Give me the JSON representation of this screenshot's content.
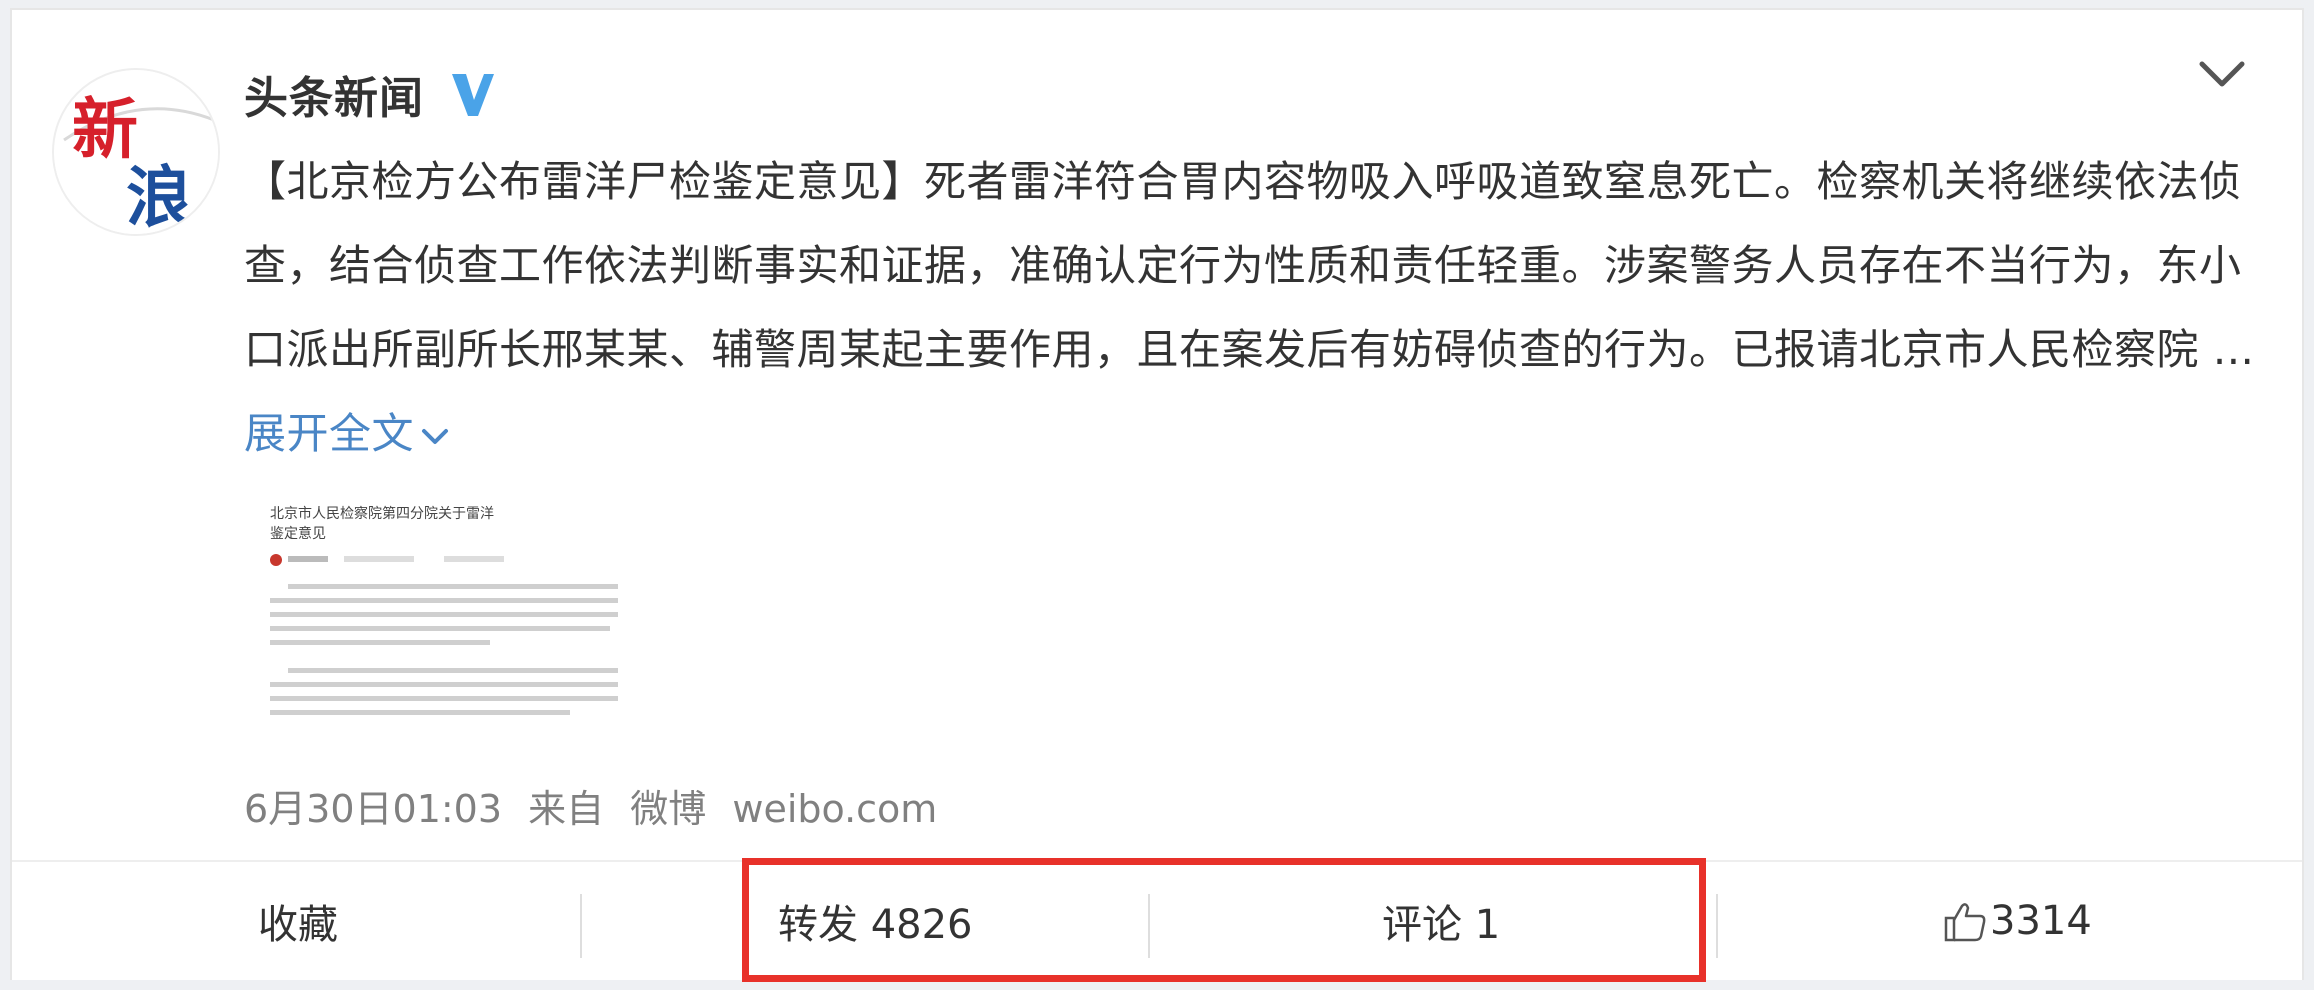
{
  "account": {
    "name": "头条新闻",
    "avatar_text_top": "新",
    "avatar_text_bottom": "浪"
  },
  "post": {
    "text": "【北京检方公布雷洋尸检鉴定意见】死者雷洋符合胃内容物吸入呼吸道致窒息死亡。检察机关将继续依法侦查，结合侦查工作依法判断事实和证据，准确认定行为性质和责任轻重。涉案警务人员存在不当行为，东小口派出所副所长邢某某、辅警周某起主要作用，且在案发后有妨碍侦查的行为。已报请北京市人民检察院 ...",
    "expand_label": "展开全文",
    "thumbnail": {
      "title_line1": "北京市人民检察院第四分院关于雷洋",
      "title_line2": "鉴定意见"
    },
    "timestamp": "6月30日01:03",
    "source_prefix": "来自",
    "source_app": "微博",
    "source_domain": "weibo.com"
  },
  "actions": {
    "favorite": "收藏",
    "repost": "转发 4826",
    "comment": "评论 1",
    "like_count": "3314"
  },
  "colors": {
    "link": "#4a86c6",
    "verified": "#4aa3e8",
    "highlight": "#e8312a",
    "brand_red": "#d6202b",
    "brand_blue": "#1d4f9c"
  },
  "icons": {
    "verified": "verified-v-icon",
    "chevron": "chevron-down-icon",
    "like": "thumbs-up-icon"
  }
}
